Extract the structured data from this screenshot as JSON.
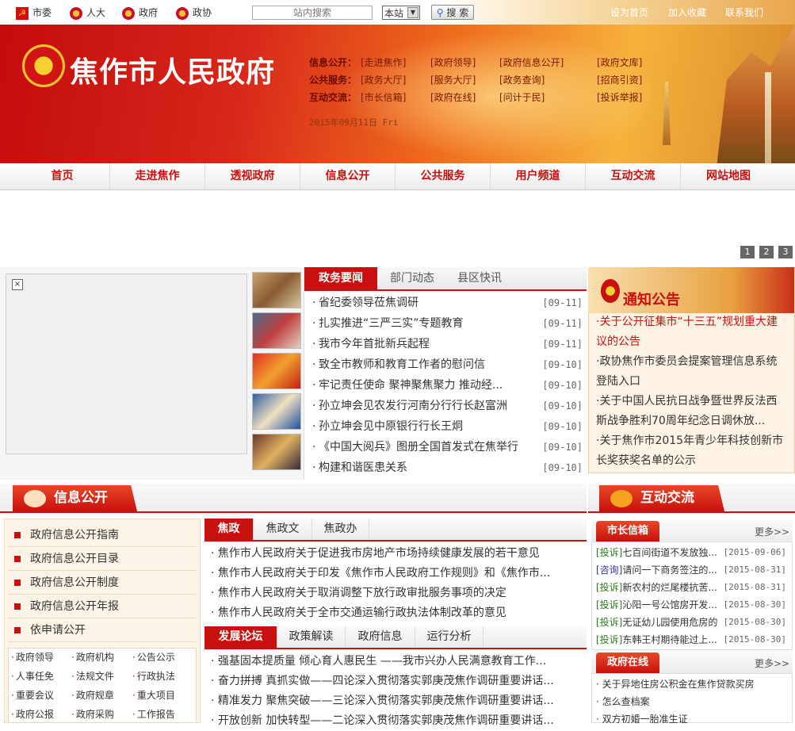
{
  "topbar": {
    "links": [
      "市委",
      "人大",
      "政府",
      "政协"
    ],
    "search_placeholder": "站内搜索",
    "scope": "本站",
    "search_button": "搜 索",
    "right_links": [
      "设为首页",
      "加入收藏",
      "联系我们"
    ]
  },
  "banner": {
    "title": "焦作市人民政府",
    "date": "2015年09月11日 Fri",
    "rows": [
      {
        "head": "信息公开：",
        "links": [
          "[走进焦作]",
          "[政府领导]",
          "[政府信息公开]",
          "[政府文库]"
        ]
      },
      {
        "head": "公共服务：",
        "links": [
          "[政务大厅]",
          "[服务大厅]",
          "[政务查询]",
          "[招商引资]"
        ]
      },
      {
        "head": "互动交流：",
        "links": [
          "[市长信箱]",
          "[政府在线]",
          "[问计于民]",
          "[投诉举报]"
        ]
      }
    ]
  },
  "nav": [
    "首页",
    "走进焦作",
    "透视政府",
    "信息公开",
    "公共服务",
    "用户频道",
    "互动交流",
    "网站地图"
  ],
  "carousel": {
    "pages": [
      "1",
      "2",
      "3"
    ]
  },
  "news": {
    "tabs": [
      "政务要闻",
      "部门动态",
      "县区快讯"
    ],
    "items": [
      {
        "title": "省纪委领导莅焦调研",
        "date": "[09-11]"
      },
      {
        "title": "扎实推进“三严三实”专题教育",
        "date": "[09-11]"
      },
      {
        "title": "我市今年首批新兵起程",
        "date": "[09-11]"
      },
      {
        "title": "致全市教师和教育工作者的慰问信",
        "date": "[09-10]"
      },
      {
        "title": "牢记责任使命  聚神聚焦聚力 推动经...",
        "date": "[09-10]"
      },
      {
        "title": "孙立坤会见农发行河南分行行长赵富洲",
        "date": "[09-10]"
      },
      {
        "title": "孙立坤会见中原银行行长王炯",
        "date": "[09-10]"
      },
      {
        "title": "《中国大阅兵》图册全国首发式在焦举行",
        "date": "[09-10]"
      },
      {
        "title": "构建和谐医患关系",
        "date": "[09-10]"
      }
    ]
  },
  "notice": {
    "title": "通知公告",
    "items": [
      {
        "text": "·关于公开征集市“十三五”规划重大建议的公告",
        "red": true
      },
      {
        "text": "·政协焦作市委员会提案管理信息系统登陆入口",
        "red": false
      },
      {
        "text": "·关于中国人民抗日战争暨世界反法西斯战争胜利70周年纪念日调休放...",
        "red": false
      },
      {
        "text": "·关于焦作市2015年青少年科技创新市长奖获奖名单的公示",
        "red": false
      }
    ]
  },
  "sections": {
    "info": "信息公开",
    "interact": "互动交流"
  },
  "info_list": [
    "政府信息公开指南",
    "政府信息公开目录",
    "政府信息公开制度",
    "政府信息公开年报",
    "依申请公开"
  ],
  "info_grid": [
    "政府领导",
    "政府机构",
    "公告公示",
    "人事任免",
    "法规文件",
    "行政执法",
    "重要会议",
    "政府规章",
    "重大项目",
    "政府公报",
    "政府采购",
    "工作报告"
  ],
  "jiaozheng": {
    "tabs": [
      "焦政",
      "焦政文",
      "焦政办"
    ],
    "items": [
      "焦作市人民政府关于促进我市房地产市场持续健康发展的若干意见",
      "焦作市人民政府关于印发《焦作市人民政府工作规则》和《焦作市...",
      "焦作市人民政府关于取消调整下放行政审批服务事项的决定",
      "焦作市人民政府关于全市交通运输行政执法体制改革的意见"
    ]
  },
  "forum": {
    "tabs": [
      "发展论坛",
      "政策解读",
      "政府信息",
      "运行分析"
    ],
    "items": [
      "强基固本提质量 倾心育人惠民生 ——我市兴办人民满意教育工作...",
      "奋力拼搏 真抓实做——四论深入贯彻落实郭庚茂焦作调研重要讲话...",
      "精准发力 聚焦突破——三论深入贯彻落实郭庚茂焦作调研重要讲话...",
      "开放创新 加快转型——二论深入贯彻落实郭庚茂焦作调研重要讲话..."
    ]
  },
  "mayor_box": {
    "title": "市长信箱",
    "more": "更多>>",
    "items": [
      {
        "tag": "[投诉]",
        "text": "七百间街道不发放独...",
        "date": "[2015-09-06]"
      },
      {
        "tag": "[咨询]",
        "text": "请问一下商务签注的...",
        "date": "[2015-08-31]"
      },
      {
        "tag": "[投诉]",
        "text": "新农村的烂尾楼抗苦...",
        "date": "[2015-08-31]"
      },
      {
        "tag": "[投诉]",
        "text": "沁阳一号公馆房开发...",
        "date": "[2015-08-30]"
      },
      {
        "tag": "[投诉]",
        "text": "无证幼儿园使用危房的",
        "date": "[2015-08-30]"
      },
      {
        "tag": "[投诉]",
        "text": "东韩王村期待能过上...",
        "date": "[2015-08-30]"
      }
    ]
  },
  "online_box": {
    "title": "政府在线",
    "more": "更多>>",
    "items": [
      "· 关于异地住房公积金在焦作贷款买房",
      "· 怎么查档案",
      "· 双方初婚一胎准生证"
    ]
  }
}
